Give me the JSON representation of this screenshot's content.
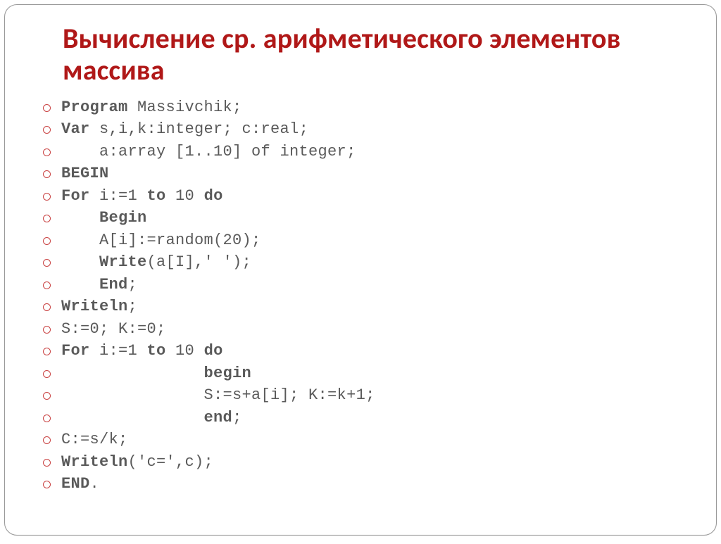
{
  "title": "Вычисление  ср. арифметического элементов массива",
  "code": [
    {
      "pre_kw": "Program",
      "rest": " Massivchik;"
    },
    {
      "pre_kw": "Var",
      "rest": " s,i,k:integer; c:real;"
    },
    {
      "plain": "    a:array [1..10] of integer;"
    },
    {
      "pre_kw": "BEGIN",
      "rest": ""
    },
    {
      "pre_kw": "For",
      "mid": " i:=1 ",
      "mid_kw": "to",
      "mid2": " 10 ",
      "end_kw": "do"
    },
    {
      "indent": "    ",
      "pre_kw": "Begin"
    },
    {
      "plain": "    A[i]:=random(20);"
    },
    {
      "indent": "    ",
      "pre_kw": "Write",
      "rest": "(a[I],' ');"
    },
    {
      "indent": "    ",
      "pre_kw": "End",
      "rest": ";"
    },
    {
      "pre_kw": "Writeln",
      "rest": ";"
    },
    {
      "plain": "S:=0; K:=0;"
    },
    {
      "pre_kw": "For",
      "mid": " i:=1 ",
      "mid_kw": "to",
      "mid2": " 10 ",
      "end_kw": "do"
    },
    {
      "indent": "               ",
      "pre_kw": "begin"
    },
    {
      "plain": "               S:=s+a[i]; K:=k+1;"
    },
    {
      "indent": "               ",
      "pre_kw": "end",
      "rest": ";"
    },
    {
      "plain": "C:=s/k;"
    },
    {
      "pre_kw": "Writeln",
      "rest": "('c=',c);"
    },
    {
      "pre_kw": "END",
      "rest": "."
    }
  ]
}
